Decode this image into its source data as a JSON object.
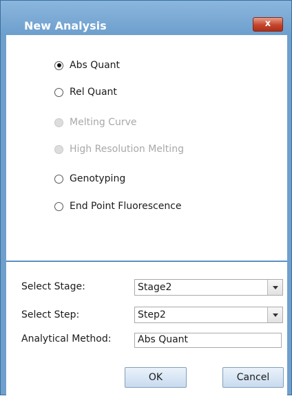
{
  "window": {
    "title": "New Analysis",
    "close_label": "x"
  },
  "analysis_types": [
    {
      "label": "Abs Quant",
      "checked": true,
      "enabled": true
    },
    {
      "label": "Rel Quant",
      "checked": false,
      "enabled": true
    },
    {
      "label": "Melting Curve",
      "checked": false,
      "enabled": false
    },
    {
      "label": "High Resolution Melting",
      "checked": false,
      "enabled": false
    },
    {
      "label": "Genotyping",
      "checked": false,
      "enabled": true
    },
    {
      "label": "End Point Fluorescence",
      "checked": false,
      "enabled": true
    }
  ],
  "settings": {
    "stage_label": "Select Stage:",
    "stage_value": "Stage2",
    "step_label": "Select Step:",
    "step_value": "Step2",
    "method_label": "Analytical Method:",
    "method_value": "Abs Quant"
  },
  "buttons": {
    "ok": "OK",
    "cancel": "Cancel"
  }
}
